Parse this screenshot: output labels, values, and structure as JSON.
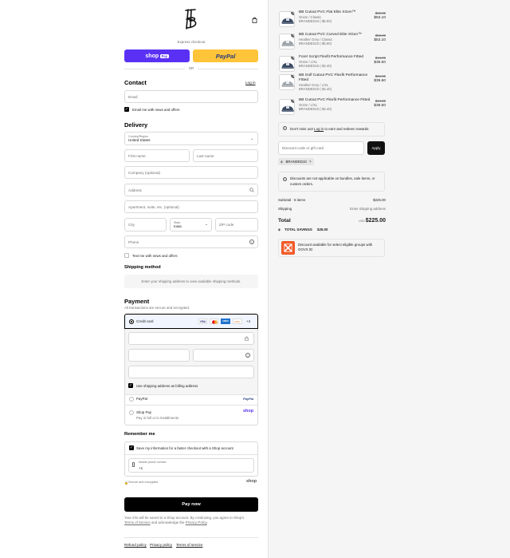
{
  "header": {
    "express_label": "Express checkout",
    "or_label": "OR",
    "shop_pay_label": "shop",
    "shop_pay_badge": "Pay",
    "paypal_label": "PayPal"
  },
  "contact": {
    "title": "Contact",
    "login": "Log in",
    "email_placeholder": "Email",
    "newsletter_label": "Email me with news and offers"
  },
  "delivery": {
    "title": "Delivery",
    "country_label": "Country/Region",
    "country_value": "United States",
    "first_name": "First name",
    "last_name": "Last name",
    "company": "Company (optional)",
    "address": "Address",
    "apartment": "Apartment, suite, etc. (optional)",
    "city": "City",
    "state_label": "State",
    "state_value": "Iowa",
    "zip": "ZIP code",
    "phone": "Phone",
    "text_me": "Text me with news and offers"
  },
  "shipping": {
    "title": "Shipping method",
    "message": "Enter your shipping address to view available shipping methods."
  },
  "payment": {
    "title": "Payment",
    "subtitle": "All transactions are secure and encrypted.",
    "credit_card": "Credit card",
    "more_cards": "+4",
    "card_brands": [
      "VISA",
      "MC",
      "AMEX",
      "DISC"
    ],
    "billing_label": "Use shipping address as billing address",
    "paypal": "PayPal",
    "shop_pay": "Shop Pay",
    "shop_pay_sub": "Pay in full or in installments",
    "shop_logo": "shop"
  },
  "remember": {
    "title": "Remember me",
    "save_label": "Save my information for a faster checkout with a Shop account",
    "mobile_label": "Mobile phone number",
    "mobile_value": "+1",
    "secure": "Secure and encrypted",
    "shop_logo": "shop"
  },
  "pay_button": "Pay now",
  "legal": {
    "text_1": "Your info will be saved to a Shop account. By continuing, you agree to Shop's",
    "terms": "Terms of Service",
    "and": "and acknowledge the",
    "privacy": "Privacy Policy",
    "period": "."
  },
  "footer": {
    "refund": "Refund policy",
    "privacy": "Privacy policy",
    "terms": "Terms of service"
  },
  "cart": {
    "items": [
      {
        "qty": "1",
        "name": "BB Cutout PVC Flat Elite XGen™",
        "variant": "Onion / Classic",
        "discount": "BRANDED10 (-$5.90)",
        "old": "$59.00",
        "price": "$53.10",
        "color": "#3b4a63"
      },
      {
        "qty": "1",
        "name": "BB Cutout PVC Curved Elite XGen™",
        "variant": "Heather Grey / Classic",
        "discount": "BRANDED10 (-$5.90)",
        "old": "$59.00",
        "price": "$53.10",
        "color": "#9da3a8"
      },
      {
        "qty": "1",
        "name": "Fore! Script Flexfit Performance Fitted",
        "variant": "Onion / L/XL",
        "discount": "BRANDED10 (-$4.40)",
        "old": "$44.00",
        "price": "$39.60",
        "color": "#3b4a63"
      },
      {
        "qty": "1",
        "name": "BB Golf Cutout PVC Flexfit Performance Fitted",
        "variant": "Heather Grey / L/XL",
        "discount": "BRANDED10 (-$4.40)",
        "old": "$44.00",
        "price": "$39.60",
        "color": "#a3a8ad"
      },
      {
        "qty": "1",
        "name": "BB Cutout PVC Flexfit Performance Fitted",
        "variant": "Onion / L/XL",
        "discount": "BRANDED10 (-$4.40)",
        "old": "$44.00",
        "price": "$39.60",
        "color": "#3b4a63"
      }
    ],
    "rewards_text": "Don't miss out!",
    "rewards_login": "Log in",
    "rewards_rest": "to earn and redeem rewards",
    "discount_placeholder": "Discount code or gift card",
    "apply": "Apply",
    "applied_code": "BRANDED10",
    "notice": "Discounts are not applicable on bundles, sale items, or custom orders.",
    "subtotal_label": "Subtotal · 5 items",
    "subtotal_value": "$225.00",
    "shipping_label": "Shipping",
    "shipping_value": "Enter shipping address",
    "total_label": "Total",
    "currency": "USD",
    "total_value": "$225.00",
    "savings_label": "TOTAL SAVINGS",
    "savings_value": "$25.00",
    "govx_text": "Discount available for select eligible groups with GOVX ID"
  }
}
